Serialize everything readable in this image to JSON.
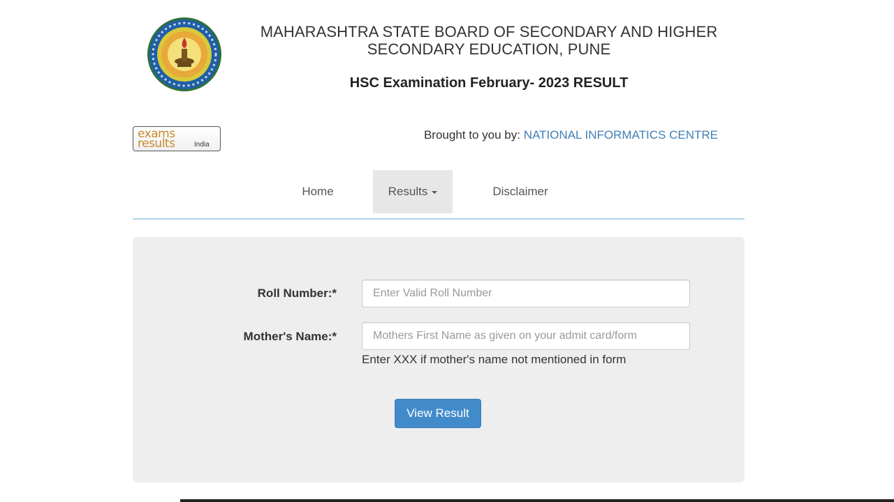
{
  "header": {
    "board_line1": "MAHARASHTRA STATE BOARD OF SECONDARY AND HIGHER",
    "board_line2": "SECONDARY EDUCATION, PUNE",
    "exam_title": "HSC Examination February- 2023 RESULT",
    "seal_icon": "msbshse-seal-icon"
  },
  "branding": {
    "logo_line1": "exams",
    "logo_line2": "results",
    "logo_line3": "India",
    "credit_prefix": "Brought to you by:",
    "credit_org": "NATIONAL INFORMATICS CENTRE"
  },
  "nav": {
    "home": "Home",
    "results": "Results",
    "disclaimer": "Disclaimer"
  },
  "form": {
    "roll_label": "Roll Number:*",
    "roll_placeholder": "Enter Valid Roll Number",
    "roll_value": "",
    "mother_label": "Mother's Name:*",
    "mother_placeholder": "Mothers First Name as given on your admit card/form",
    "mother_value": "",
    "mother_help": "Enter XXX if mother's name not mentioned in form",
    "submit_label": "View Result"
  },
  "colors": {
    "accent_link": "#3f7fb5",
    "button": "#428bca",
    "panel_bg": "#eeeeee",
    "nav_active_bg": "#e7e7e7",
    "nav_divider": "#aed4e6",
    "logo_gold": "#c58a2a"
  }
}
